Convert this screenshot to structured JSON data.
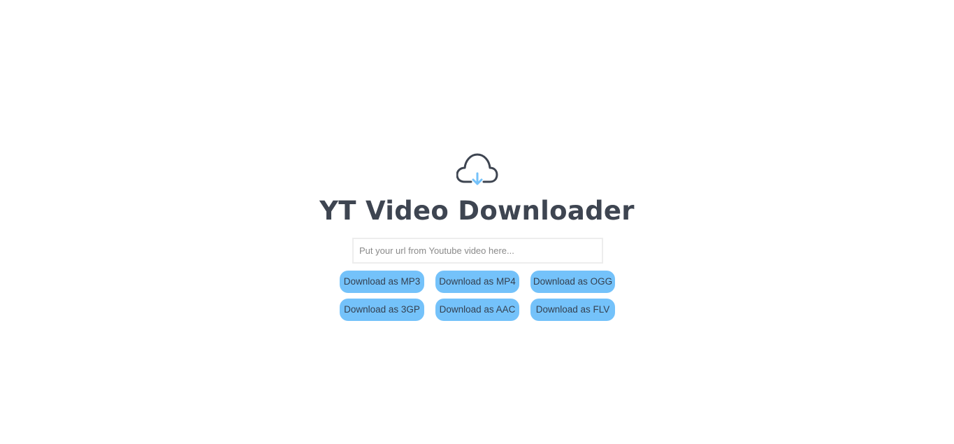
{
  "header": {
    "logo_icon": "cloud-download-icon",
    "title": "YT Video Downloader"
  },
  "search": {
    "value": "",
    "placeholder": "Put your url from Youtube video here..."
  },
  "buttons": [
    {
      "label": "Download as MP3"
    },
    {
      "label": "Download as MP4"
    },
    {
      "label": "Download as OGG"
    },
    {
      "label": "Download as 3GP"
    },
    {
      "label": "Download as AAC"
    },
    {
      "label": "Download as FLV"
    }
  ],
  "colors": {
    "accent": "#74c2fa",
    "text_dark": "#3e4551",
    "arrow": "#74c2fa"
  }
}
